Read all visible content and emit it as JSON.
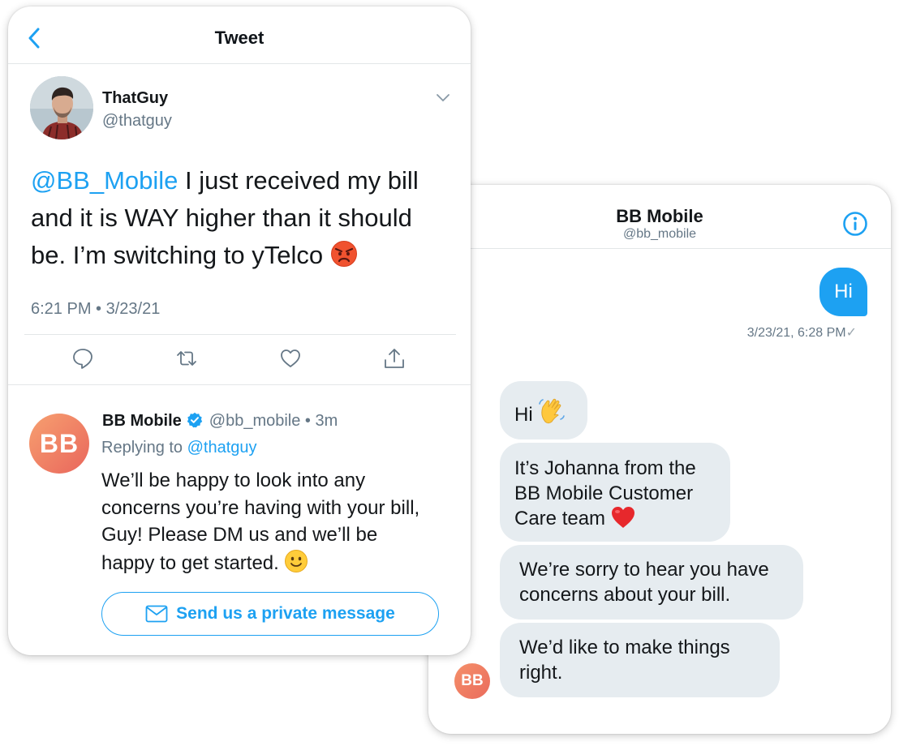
{
  "tweet_screen": {
    "header_title": "Tweet",
    "author": {
      "name": "ThatGuy",
      "handle": "@thatguy"
    },
    "tweet": {
      "mention": "@BB_Mobile",
      "text": " I just received my bill and it is WAY higher than it should be. I’m switching to yTelco ",
      "emoji": "angry-face-icon",
      "time": "6:21 PM • 3/23/21"
    },
    "actions": [
      "reply-icon",
      "retweet-icon",
      "like-icon",
      "share-icon"
    ],
    "reply": {
      "avatar_initials": "BB",
      "name": "BB Mobile",
      "handle_time": "@bb_mobile • 3m",
      "replying_prefix": "Replying to ",
      "replying_handle": "@thatguy",
      "text": "We’ll be happy to look into any concerns you’re having with your bill, Guy! Please DM us and we’ll be happy to get started. ",
      "emoji": "smiling-face-icon",
      "button_label": "Send us a private message"
    }
  },
  "dm_screen": {
    "title": "BB Mobile",
    "handle": "@bb_mobile",
    "avatar_initials": "BB",
    "messages": [
      {
        "from": "user",
        "text": "Hi"
      },
      {
        "from": "brand",
        "text": "Hi ",
        "emoji": "waving-hand-icon"
      },
      {
        "from": "brand",
        "text": "It’s Johanna from the BB Mobile Customer Care team ",
        "emoji": "red-heart-icon"
      },
      {
        "from": "brand",
        "text": "We’re sorry to hear you have concerns about your bill."
      },
      {
        "from": "brand",
        "text": "We’d like to make things right."
      }
    ],
    "sent_time": "3/23/21, 6:28 PM",
    "sent_check": "✓"
  },
  "colors": {
    "accent": "#1da1f2",
    "text": "#14171a",
    "muted": "#657786",
    "bubble_in": "#e6ecf0",
    "brand_gradient_start": "#f7a070",
    "brand_gradient_end": "#e9665c"
  }
}
